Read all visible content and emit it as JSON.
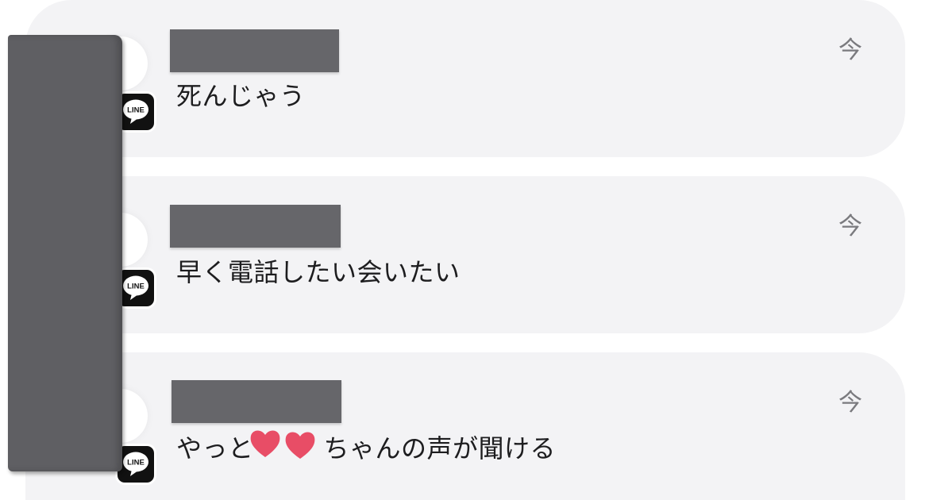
{
  "notifications": [
    {
      "app": "LINE",
      "time": "今",
      "message": "死んじゃう"
    },
    {
      "app": "LINE",
      "time": "今",
      "message": "早く電話したい会いたい"
    },
    {
      "app": "LINE",
      "time": "今",
      "message_before": "やっと",
      "message_after": "ちゃんの声が聞ける"
    }
  ],
  "colors": {
    "card": "#f3f3f5",
    "heart": "#e84d66",
    "redaction": "#66666a"
  },
  "icons": {
    "app_badge": "line-app-icon",
    "redaction": "heart-sticker-icon"
  }
}
